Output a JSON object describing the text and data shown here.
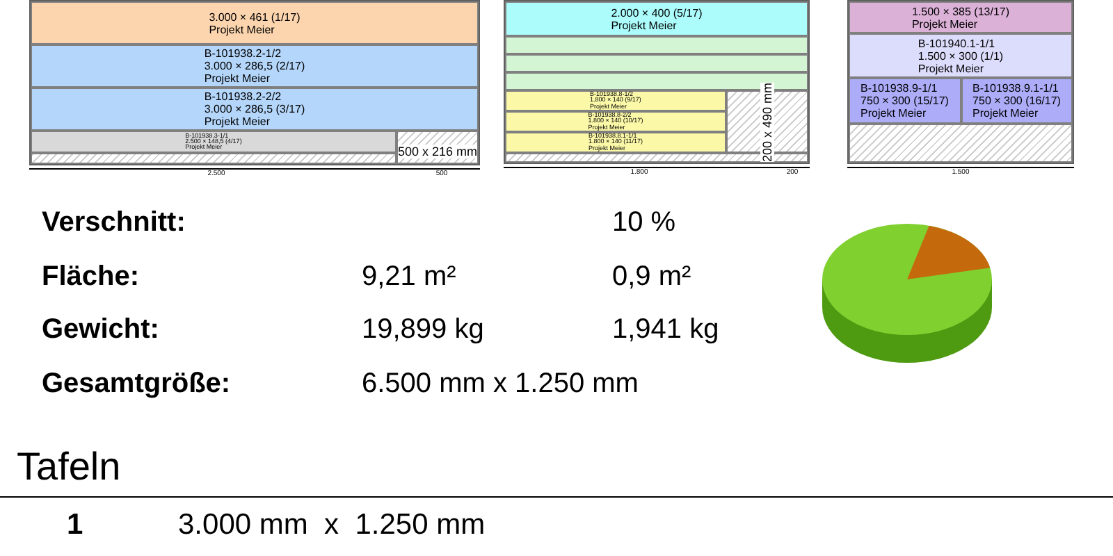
{
  "sheets": [
    {
      "rows": [
        {
          "cells": [
            {
              "kind": "piece",
              "color": "#fcd5ae",
              "lines": [
                "3.000 × 461 (1/17)",
                "Projekt Meier"
              ]
            }
          ]
        },
        {
          "cells": [
            {
              "kind": "piece",
              "color": "#b4d6fa",
              "lines": [
                "B-101938.2-1/2",
                "3.000 × 286,5 (2/17)",
                "Projekt Meier"
              ]
            }
          ]
        },
        {
          "cells": [
            {
              "kind": "piece",
              "color": "#b4d6fa",
              "lines": [
                "B-101938.2-2/2",
                "3.000 × 286,5 (3/17)",
                "Projekt Meier"
              ]
            }
          ]
        },
        {
          "cells": [
            {
              "kind": "stack",
              "cells": [
                {
                  "kind": "piece",
                  "color": "#d9d9d9",
                  "lines": [
                    "B-101938.3-1/1",
                    "2.500 × 148,5 (4/17)",
                    "Projekt Meier"
                  ]
                },
                {
                  "kind": "waste"
                }
              ]
            },
            {
              "kind": "offcut",
              "lines": [
                "500 x 216 mm"
              ]
            }
          ]
        }
      ],
      "axis_labels": [
        "2.500",
        "500"
      ]
    },
    {
      "rows": [
        {
          "cells": [
            {
              "kind": "piece",
              "color": "#acfcfc",
              "lines": [
                "2.000 × 400 (5/17)",
                "Projekt Meier"
              ]
            }
          ]
        },
        {
          "cells": [
            {
              "kind": "piece",
              "color": "#d4f5d4"
            }
          ]
        },
        {
          "cells": [
            {
              "kind": "piece",
              "color": "#d4f5d4"
            }
          ]
        },
        {
          "cells": [
            {
              "kind": "piece",
              "color": "#d4f5d4"
            }
          ]
        },
        {
          "cells": [
            {
              "kind": "stack",
              "cells": [
                {
                  "kind": "piece",
                  "color": "#fbf8a8",
                  "lines": [
                    "B-101938.8-1/2",
                    "1.800 × 140 (9/17)",
                    "Projekt Meier"
                  ]
                },
                {
                  "kind": "piece",
                  "color": "#fbf8a8",
                  "lines": [
                    "B-101938.8-2/2",
                    "1.800 × 140 (10/17)",
                    "Projekt Meier"
                  ]
                },
                {
                  "kind": "piece",
                  "color": "#fbf8a8",
                  "lines": [
                    "B-101938.8.1-1/1",
                    "1.800 × 140 (11/17)",
                    "Projekt Meier"
                  ]
                }
              ]
            },
            {
              "kind": "offcut_vertical",
              "lines": [
                "200 x 490 mm"
              ]
            }
          ]
        },
        {
          "cells": [
            {
              "kind": "waste"
            }
          ]
        }
      ],
      "axis_labels": [
        "1.800",
        "200"
      ]
    },
    {
      "rows": [
        {
          "cells": [
            {
              "kind": "piece",
              "color": "#dcb1d8",
              "lines": [
                "1.500 × 385 (13/17)",
                "Projekt Meier"
              ]
            }
          ]
        },
        {
          "cells": [
            {
              "kind": "piece",
              "color": "#dcdcfc",
              "lines": [
                "B-101940.1-1/1",
                "1.500 × 300 (1/1)",
                "Projekt Meier"
              ]
            }
          ]
        },
        {
          "cells": [
            {
              "kind": "piece",
              "color": "#acacf8",
              "lines": [
                "B-101938.9-1/1",
                "750 × 300 (15/17)",
                "Projekt Meier"
              ]
            },
            {
              "kind": "piece",
              "color": "#acacf8",
              "lines": [
                "B-101938.9.1-1/1",
                "750 × 300 (16/17)",
                "Projekt Meier"
              ]
            }
          ]
        },
        {
          "cells": [
            {
              "kind": "waste"
            }
          ]
        }
      ],
      "axis_labels": [
        "1.500"
      ]
    }
  ],
  "stats": [
    {
      "label": "Verschnitt:",
      "waste": "10 %"
    },
    {
      "label": "Fläche:",
      "total": "9,21 m²",
      "waste": "0,9 m²"
    },
    {
      "label": "Gewicht:",
      "total": "19,899 kg",
      "waste": "1,941 kg"
    },
    {
      "label": "Gesamtgröße:",
      "total": "6.500 mm x 1.250 mm"
    }
  ],
  "section": {
    "title": "Tafeln"
  },
  "tafeln": [
    {
      "number": "1",
      "size": "3.000 mm  x  1.250 mm"
    }
  ]
}
